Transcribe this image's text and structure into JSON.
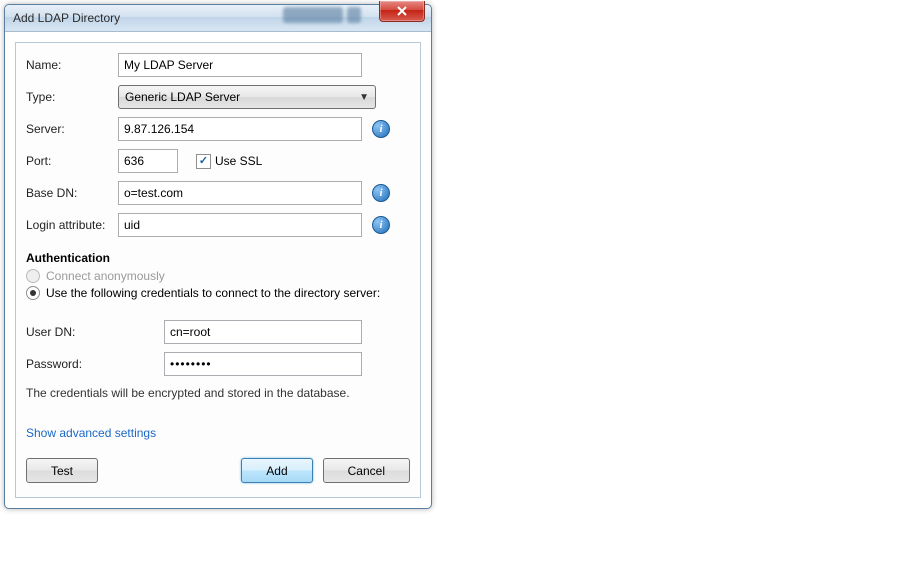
{
  "window": {
    "title": "Add LDAP Directory"
  },
  "labels": {
    "name": "Name:",
    "type": "Type:",
    "server": "Server:",
    "port": "Port:",
    "useSSL": "Use SSL",
    "baseDN": "Base DN:",
    "loginAttr": "Login attribute:",
    "authHeader": "Authentication",
    "connectAnon": "Connect anonymously",
    "useCreds": "Use the following credentials to connect to the directory server:",
    "userDN": "User DN:",
    "password": "Password:",
    "credsNote": "The credentials will be encrypted and stored in the database.",
    "advanced": "Show advanced settings"
  },
  "values": {
    "name": "My LDAP Server",
    "type": "Generic LDAP Server",
    "server": "9.87.126.154",
    "port": "636",
    "useSSL": true,
    "baseDN": "o=test.com",
    "loginAttr": "uid",
    "authMode": "credentials",
    "userDN": "cn=root",
    "password": "••••••••"
  },
  "buttons": {
    "test": "Test",
    "add": "Add",
    "cancel": "Cancel"
  }
}
